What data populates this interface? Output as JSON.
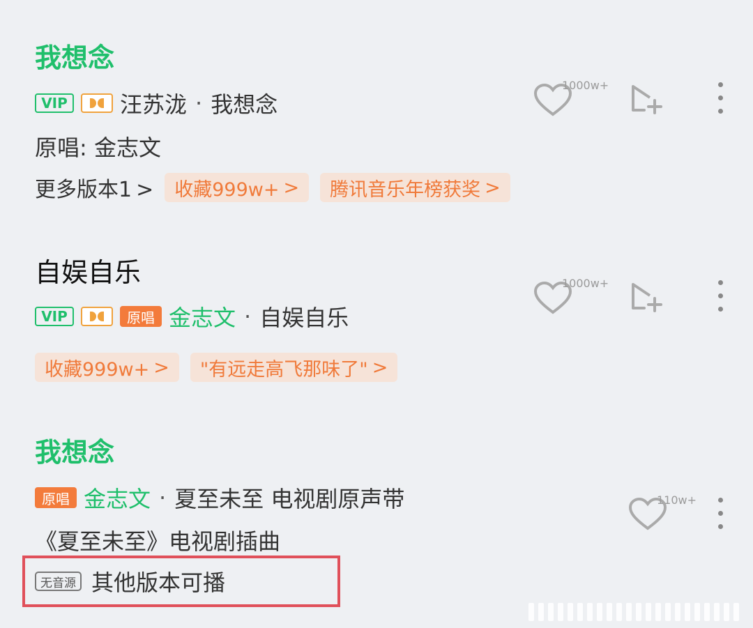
{
  "songs": [
    {
      "title": "我想念",
      "tags": [
        "VIP"
      ],
      "artist": "汪苏泷",
      "separator": "·",
      "album": "我想念",
      "original_singer_label": "原唱: 金志文",
      "more_versions": "更多版本1",
      "pills": [
        "收藏999w+",
        "腾讯音乐年榜获奖"
      ],
      "like_count": "1000w+"
    },
    {
      "title": "自娱自乐",
      "tags": [
        "VIP",
        "原唱"
      ],
      "artist": "金志文",
      "separator": "·",
      "album": "自娱自乐",
      "pills": [
        "收藏999w+",
        "\"有远走高飞那味了\""
      ],
      "like_count": "1000w+"
    },
    {
      "title": "我想念",
      "tags": [
        "原唱"
      ],
      "artist": "金志文",
      "separator": "·",
      "album": "夏至未至 电视剧原声带",
      "description": "《夏至未至》电视剧插曲",
      "no_source_badge": "无音源",
      "alt_version_text": "其他版本可播",
      "like_count": "110w+"
    }
  ],
  "chevron": ">",
  "colors": {
    "accent_green": "#1fbf6b",
    "pill_orange": "#f07a3a",
    "highlight_red": "#e0505a"
  },
  "icons": [
    "heart-icon",
    "add-to-playlist-icon",
    "more-icon",
    "dolby-icon"
  ]
}
